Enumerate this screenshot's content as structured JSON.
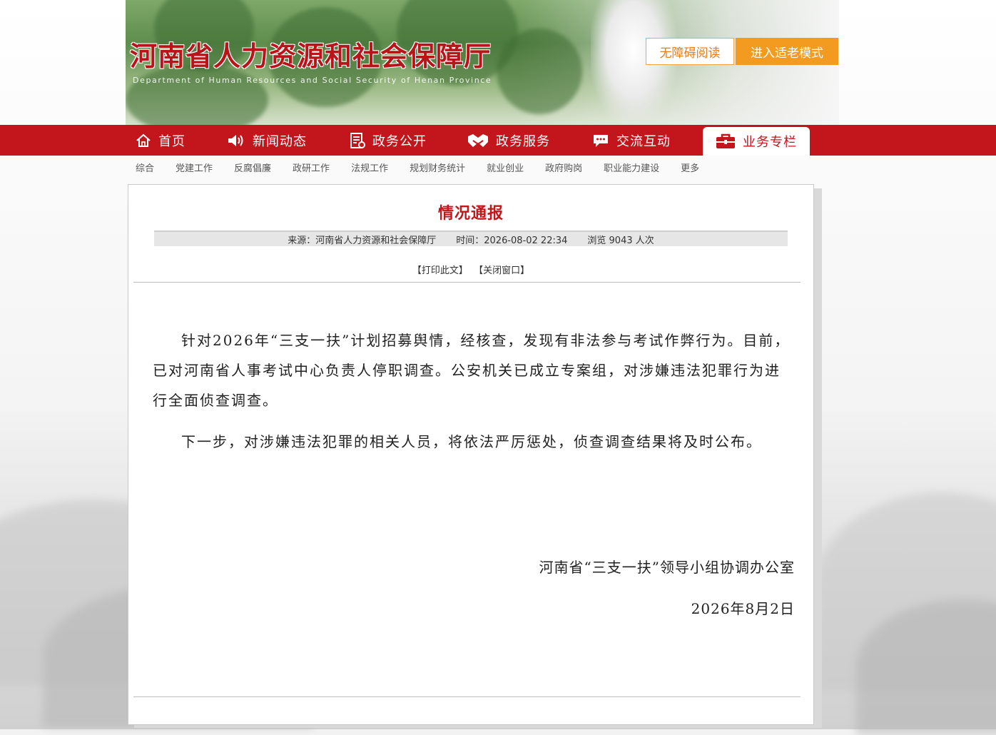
{
  "header": {
    "title": "河南省人力资源和社会保障厅",
    "subtitle": "Department of Human Resources and Social Security of Henan Province",
    "accessibility_button": "无障碍阅读",
    "elder_mode_button": "进入适老模式"
  },
  "nav": {
    "items": [
      {
        "label": "首页",
        "icon": "home-icon"
      },
      {
        "label": "新闻动态",
        "icon": "speaker-icon"
      },
      {
        "label": "政务公开",
        "icon": "document-icon"
      },
      {
        "label": "政务服务",
        "icon": "handshake-icon"
      },
      {
        "label": "交流互动",
        "icon": "chat-icon"
      },
      {
        "label": "业务专栏",
        "icon": "briefcase-icon",
        "active": true
      }
    ]
  },
  "subnav": [
    "综合",
    "党建工作",
    "反腐倡廉",
    "政研工作",
    "法规工作",
    "规划财务统计",
    "就业创业",
    "政府购岗",
    "职业能力建设",
    "更多"
  ],
  "article": {
    "title": "情况通报",
    "source": "来源：河南省人力资源和社会保障厅",
    "time": "时间：2026-08-02 22:34",
    "views": "浏览 9043 人次",
    "print_link": "【打印此文】",
    "close_link": "【关闭窗口】",
    "paragraphs": [
      "针对2026年“三支一扶”计划招募舆情，经核查，发现有非法参与考试作弊行为。目前，已对河南省人事考试中心负责人停职调查。公安机关已成立专案组，对涉嫌违法犯罪行为进行全面侦查调查。",
      "下一步，对涉嫌违法犯罪的相关人员，将依法严厉惩处，侦查调查结果将及时公布。"
    ],
    "signature": "河南省“三支一扶”领导小组协调办公室",
    "date": "2026年8月2日"
  },
  "colors": {
    "brand_red": "#c3161c",
    "accent_orange": "#f39a20"
  }
}
